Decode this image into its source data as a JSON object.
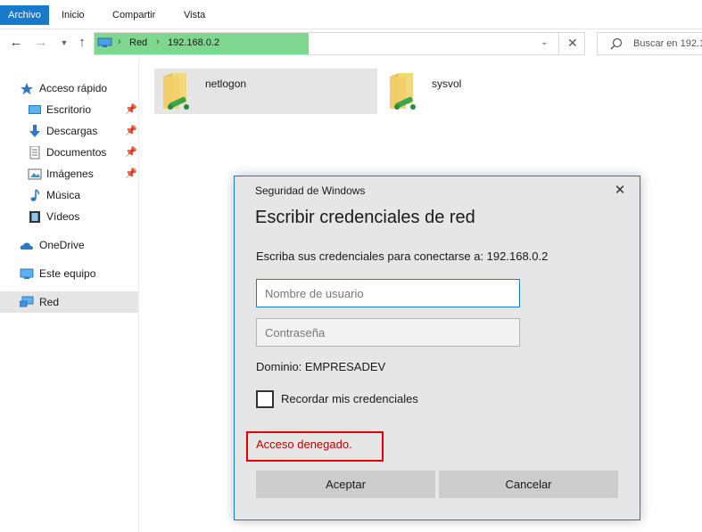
{
  "ribbon": {
    "tabs": [
      {
        "label": "Archivo"
      },
      {
        "label": "Inicio"
      },
      {
        "label": "Compartir"
      },
      {
        "label": "Vista"
      }
    ]
  },
  "address": {
    "breadcrumbs": [
      "Red",
      "192.168.0.2"
    ],
    "search_placeholder": "Buscar en 192.1"
  },
  "sidebar": {
    "items": [
      {
        "label": "Acceso rápido",
        "icon": "star-icon"
      },
      {
        "label": "Escritorio",
        "icon": "desktop-icon",
        "pinned": true
      },
      {
        "label": "Descargas",
        "icon": "download-icon",
        "pinned": true
      },
      {
        "label": "Documentos",
        "icon": "document-icon",
        "pinned": true
      },
      {
        "label": "Imágenes",
        "icon": "image-icon",
        "pinned": true
      },
      {
        "label": "Música",
        "icon": "music-icon"
      },
      {
        "label": "Vídeos",
        "icon": "video-icon"
      },
      {
        "label": "OneDrive",
        "icon": "cloud-icon"
      },
      {
        "label": "Este equipo",
        "icon": "computer-icon"
      },
      {
        "label": "Red",
        "icon": "network-icon",
        "selected": true
      }
    ]
  },
  "files": [
    {
      "name": "netlogon",
      "icon": "shared-folder-icon",
      "selected": true
    },
    {
      "name": "sysvol",
      "icon": "shared-folder-icon",
      "selected": false
    }
  ],
  "dialog": {
    "title": "Seguridad de Windows",
    "heading": "Escribir credenciales de red",
    "prompt": "Escriba sus credenciales para conectarse a: 192.168.0.2",
    "username_placeholder": "Nombre de usuario",
    "password_placeholder": "Contraseña",
    "domain": "Dominio: EMPRESADEV",
    "remember_label": "Recordar mis credenciales",
    "error": "Acceso denegado.",
    "ok_label": "Aceptar",
    "cancel_label": "Cancelar"
  },
  "colors": {
    "accent": "#1979ca",
    "address_highlight": "#7fd68f",
    "error": "#c00000",
    "error_box": "#e00000"
  }
}
